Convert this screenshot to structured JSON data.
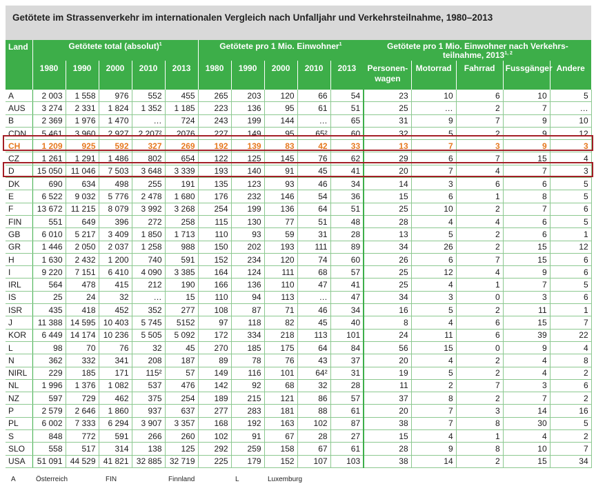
{
  "title": "Getötete im Strassenverkehr im internationalen Vergleich nach Unfalljahr und Verkehrsteilnahme, 1980–2013",
  "header": {
    "land": "Land",
    "group1": "Getötete total (absolut)",
    "group1_sup": "1",
    "group2": "Getötete pro 1 Mio. Einwohner",
    "group2_sup": "1",
    "group3_line1": "Getötete pro 1 Mio. Einwohner nach Verkehrs-",
    "group3_line2": "teilnahme, 2013",
    "group3_sup": "1, 2",
    "years": [
      "1980",
      "1990",
      "2000",
      "2010",
      "2013"
    ],
    "modes": [
      "Personen-wagen",
      "Motorrad",
      "Fahrrad",
      "Fussgänger",
      "Andere"
    ]
  },
  "rows": [
    {
      "c": "A",
      "a": [
        "2 003",
        "1 558",
        "976",
        "552",
        "455"
      ],
      "p": [
        "265",
        "203",
        "120",
        "66",
        "54"
      ],
      "m": [
        "23",
        "10",
        "6",
        "10",
        "5"
      ]
    },
    {
      "c": "AUS",
      "a": [
        "3 274",
        "2 331",
        "1 824",
        "1 352",
        "1 185"
      ],
      "p": [
        "223",
        "136",
        "95",
        "61",
        "51"
      ],
      "m": [
        "25",
        "…",
        "2",
        "7",
        "…"
      ]
    },
    {
      "c": "B",
      "a": [
        "2 369",
        "1 976",
        "1 470",
        "…",
        "724"
      ],
      "p": [
        "243",
        "199",
        "144",
        "…",
        "65"
      ],
      "m": [
        "31",
        "9",
        "7",
        "9",
        "10"
      ]
    },
    {
      "c": "CDN",
      "a": [
        "5 461",
        "3 960",
        "2 927",
        "2 207²",
        "2076"
      ],
      "p": [
        "227",
        "149",
        "95",
        "65²",
        "60"
      ],
      "m": [
        "32",
        "5",
        "2",
        "9",
        "12"
      ]
    },
    {
      "c": "CH",
      "a": [
        "1 209",
        "925",
        "592",
        "327",
        "269"
      ],
      "p": [
        "192",
        "139",
        "83",
        "42",
        "33"
      ],
      "m": [
        "13",
        "7",
        "3",
        "9",
        "3"
      ]
    },
    {
      "c": "CZ",
      "a": [
        "1 261",
        "1 291",
        "1 486",
        "802",
        "654"
      ],
      "p": [
        "122",
        "125",
        "145",
        "76",
        "62"
      ],
      "m": [
        "29",
        "6",
        "7",
        "15",
        "4"
      ]
    },
    {
      "c": "D",
      "a": [
        "15 050",
        "11 046",
        "7 503",
        "3 648",
        "3 339"
      ],
      "p": [
        "193",
        "140",
        "91",
        "45",
        "41"
      ],
      "m": [
        "20",
        "7",
        "4",
        "7",
        "3"
      ]
    },
    {
      "c": "DK",
      "a": [
        "690",
        "634",
        "498",
        "255",
        "191"
      ],
      "p": [
        "135",
        "123",
        "93",
        "46",
        "34"
      ],
      "m": [
        "14",
        "3",
        "6",
        "6",
        "5"
      ]
    },
    {
      "c": "E",
      "a": [
        "6 522",
        "9 032",
        "5 776",
        "2 478",
        "1 680"
      ],
      "p": [
        "176",
        "232",
        "146",
        "54",
        "36"
      ],
      "m": [
        "15",
        "6",
        "1",
        "8",
        "5"
      ]
    },
    {
      "c": "F",
      "a": [
        "13 672",
        "11 215",
        "8 079",
        "3 992",
        "3 268"
      ],
      "p": [
        "254",
        "199",
        "136",
        "64",
        "51"
      ],
      "m": [
        "25",
        "10",
        "2",
        "7",
        "6"
      ]
    },
    {
      "c": "FIN",
      "a": [
        "551",
        "649",
        "396",
        "272",
        "258"
      ],
      "p": [
        "115",
        "130",
        "77",
        "51",
        "48"
      ],
      "m": [
        "28",
        "4",
        "4",
        "6",
        "5"
      ]
    },
    {
      "c": "GB",
      "a": [
        "6 010",
        "5 217",
        "3 409",
        "1 850",
        "1 713"
      ],
      "p": [
        "110",
        "93",
        "59",
        "31",
        "28"
      ],
      "m": [
        "13",
        "5",
        "2",
        "6",
        "1"
      ]
    },
    {
      "c": "GR",
      "a": [
        "1 446",
        "2 050",
        "2 037",
        "1 258",
        "988"
      ],
      "p": [
        "150",
        "202",
        "193",
        "111",
        "89"
      ],
      "m": [
        "34",
        "26",
        "2",
        "15",
        "12"
      ]
    },
    {
      "c": "H",
      "a": [
        "1 630",
        "2 432",
        "1 200",
        "740",
        "591"
      ],
      "p": [
        "152",
        "234",
        "120",
        "74",
        "60"
      ],
      "m": [
        "26",
        "6",
        "7",
        "15",
        "6"
      ]
    },
    {
      "c": "I",
      "a": [
        "9 220",
        "7 151",
        "6 410",
        "4 090",
        "3 385"
      ],
      "p": [
        "164",
        "124",
        "111",
        "68",
        "57"
      ],
      "m": [
        "25",
        "12",
        "4",
        "9",
        "6"
      ]
    },
    {
      "c": "IRL",
      "a": [
        "564",
        "478",
        "415",
        "212",
        "190"
      ],
      "p": [
        "166",
        "136",
        "110",
        "47",
        "41"
      ],
      "m": [
        "25",
        "4",
        "1",
        "7",
        "5"
      ]
    },
    {
      "c": "IS",
      "a": [
        "25",
        "24",
        "32",
        "…",
        "15"
      ],
      "p": [
        "110",
        "94",
        "113",
        "…",
        "47"
      ],
      "m": [
        "34",
        "3",
        "0",
        "3",
        "6"
      ]
    },
    {
      "c": "ISR",
      "a": [
        "435",
        "418",
        "452",
        "352",
        "277"
      ],
      "p": [
        "108",
        "87",
        "71",
        "46",
        "34"
      ],
      "m": [
        "16",
        "5",
        "2",
        "11",
        "1"
      ]
    },
    {
      "c": "J",
      "a": [
        "11 388",
        "14 595",
        "10 403",
        "5 745",
        "5152"
      ],
      "p": [
        "97",
        "118",
        "82",
        "45",
        "40"
      ],
      "m": [
        "8",
        "4",
        "6",
        "15",
        "7"
      ]
    },
    {
      "c": "KOR",
      "a": [
        "6 449",
        "14 174",
        "10 236",
        "5 505",
        "5 092"
      ],
      "p": [
        "172",
        "334",
        "218",
        "113",
        "101"
      ],
      "m": [
        "24",
        "11",
        "6",
        "39",
        "22"
      ]
    },
    {
      "c": "L",
      "a": [
        "98",
        "70",
        "76",
        "32",
        "45"
      ],
      "p": [
        "270",
        "185",
        "175",
        "64",
        "84"
      ],
      "m": [
        "56",
        "15",
        "0",
        "9",
        "4"
      ]
    },
    {
      "c": "N",
      "a": [
        "362",
        "332",
        "341",
        "208",
        "187"
      ],
      "p": [
        "89",
        "78",
        "76",
        "43",
        "37"
      ],
      "m": [
        "20",
        "4",
        "2",
        "4",
        "8"
      ]
    },
    {
      "c": "NIRL",
      "a": [
        "229",
        "185",
        "171",
        "115²",
        "57"
      ],
      "p": [
        "149",
        "116",
        "101",
        "64²",
        "31"
      ],
      "m": [
        "19",
        "5",
        "2",
        "4",
        "2"
      ]
    },
    {
      "c": "NL",
      "a": [
        "1 996",
        "1 376",
        "1 082",
        "537",
        "476"
      ],
      "p": [
        "142",
        "92",
        "68",
        "32",
        "28"
      ],
      "m": [
        "11",
        "2",
        "7",
        "3",
        "6"
      ]
    },
    {
      "c": "NZ",
      "a": [
        "597",
        "729",
        "462",
        "375",
        "254"
      ],
      "p": [
        "189",
        "215",
        "121",
        "86",
        "57"
      ],
      "m": [
        "37",
        "8",
        "2",
        "7",
        "2"
      ]
    },
    {
      "c": "P",
      "a": [
        "2 579",
        "2 646",
        "1 860",
        "937",
        "637"
      ],
      "p": [
        "277",
        "283",
        "181",
        "88",
        "61"
      ],
      "m": [
        "20",
        "7",
        "3",
        "14",
        "16"
      ]
    },
    {
      "c": "PL",
      "a": [
        "6 002",
        "7 333",
        "6 294",
        "3 907",
        "3 357"
      ],
      "p": [
        "168",
        "192",
        "163",
        "102",
        "87"
      ],
      "m": [
        "38",
        "7",
        "8",
        "30",
        "5"
      ]
    },
    {
      "c": "S",
      "a": [
        "848",
        "772",
        "591",
        "266",
        "260"
      ],
      "p": [
        "102",
        "91",
        "67",
        "28",
        "27"
      ],
      "m": [
        "15",
        "4",
        "1",
        "4",
        "2"
      ]
    },
    {
      "c": "SLO",
      "a": [
        "558",
        "517",
        "314",
        "138",
        "125"
      ],
      "p": [
        "292",
        "259",
        "158",
        "67",
        "61"
      ],
      "m": [
        "28",
        "9",
        "8",
        "10",
        "7"
      ]
    },
    {
      "c": "USA",
      "a": [
        "51 091",
        "44 529",
        "41 821",
        "32 885",
        "32 719"
      ],
      "p": [
        "225",
        "179",
        "152",
        "107",
        "103"
      ],
      "m": [
        "38",
        "14",
        "2",
        "15",
        "34"
      ]
    }
  ],
  "footer": {
    "items": [
      "A",
      "Österreich",
      "FIN",
      "Finnland",
      "L",
      "Luxemburg"
    ]
  },
  "colors": {
    "header_green": "#3dae49",
    "title_gray": "#d9d9d9",
    "highlight_orange": "#e6781e",
    "frame_red": "#a31e25"
  }
}
